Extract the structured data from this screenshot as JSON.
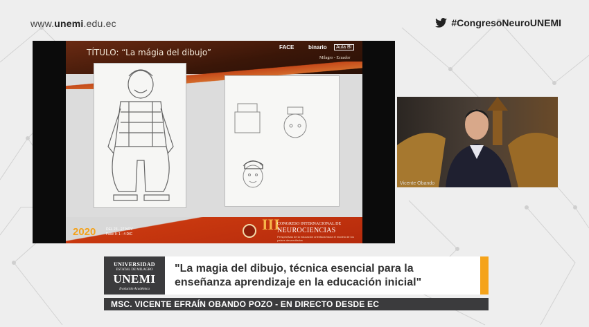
{
  "header": {
    "url_prefix": "www.",
    "url_brand": "unemi",
    "url_suffix": ".edu.ec",
    "hashtag": "#CongresoNeuroUNEMI"
  },
  "slide": {
    "title": "TÍTULO: “La mágia del dibujo”",
    "logo_face": "FACE",
    "logo_binario": "binario",
    "logo_aula": "Aula BI",
    "city": "Milagro - Ecuador",
    "year": "2020",
    "dates_line1": "DEL 23 - 27 NOV",
    "dates_line2": "Fase II: 1 - 4 DIC",
    "roman": "III",
    "congress_line1": "CONGRESO INTERNACIONAL DE",
    "congress_line2": "NEUROCIENCIAS",
    "congress_line3": "Perspectivas de la educación orientada hacia el modelo de los países desarrollados"
  },
  "webcam": {
    "name": "Vicente Obando"
  },
  "lower_third": {
    "logo_line1": "UNIVERSIDAD",
    "logo_line2": "ESTATAL DE MILAGRO",
    "logo_line3": "UNEMI",
    "logo_line4": "Evolución Académica",
    "title_line1": "\"La magia del dibujo, técnica esencial para la",
    "title_line2": "enseñanza aprendizaje en la educación inicial\"",
    "presenter": "MSC. VICENTE EFRAÍN OBANDO POZO - EN DIRECTO DESDE EC"
  },
  "colors": {
    "accent": "#f5a31a",
    "panel_dark": "#3b3b3d",
    "slide_red": "#c8380f"
  },
  "icons": {
    "twitter": "twitter-bird-icon"
  }
}
